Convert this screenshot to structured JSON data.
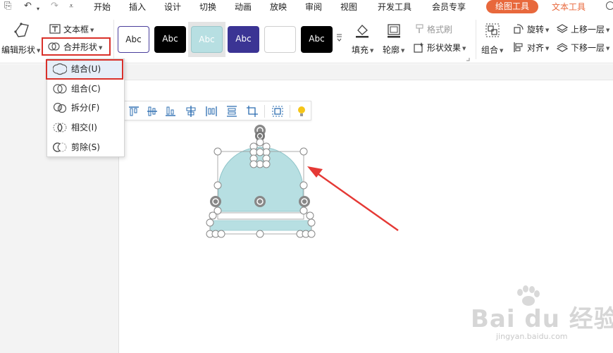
{
  "menu": {
    "tabs": [
      "开始",
      "插入",
      "设计",
      "切换",
      "动画",
      "放映",
      "审阅",
      "视图",
      "开发工具",
      "会员专享"
    ],
    "active_tab": "绘图工具",
    "text_tools_tab": "文本工具"
  },
  "ribbon": {
    "edit_shape": "编辑形状",
    "text_box": "文本框",
    "merge_shapes": "合并形状",
    "style_swatches": [
      "Abc",
      "Abc",
      "Abc",
      "Abc",
      "",
      "Abc"
    ],
    "fill": "填充",
    "outline": "轮廓",
    "format_painter": "格式刷",
    "shape_effects": "形状效果",
    "group": "组合",
    "rotate": "旋转",
    "align": "对齐",
    "bring_forward": "上移一层",
    "send_backward": "下移一层"
  },
  "merge_menu": {
    "items": [
      "结合(U)",
      "组合(C)",
      "拆分(F)",
      "相交(I)",
      "剪除(S)"
    ],
    "highlighted_index": 0
  },
  "watermark": {
    "brand": "Bai du 经验",
    "url": "jingyan.baidu.com"
  },
  "colors": {
    "accent": "#e8683c",
    "highlight_box": "#d9312a",
    "shape_fill": "#b7dfe2",
    "arrow": "#e53935"
  }
}
